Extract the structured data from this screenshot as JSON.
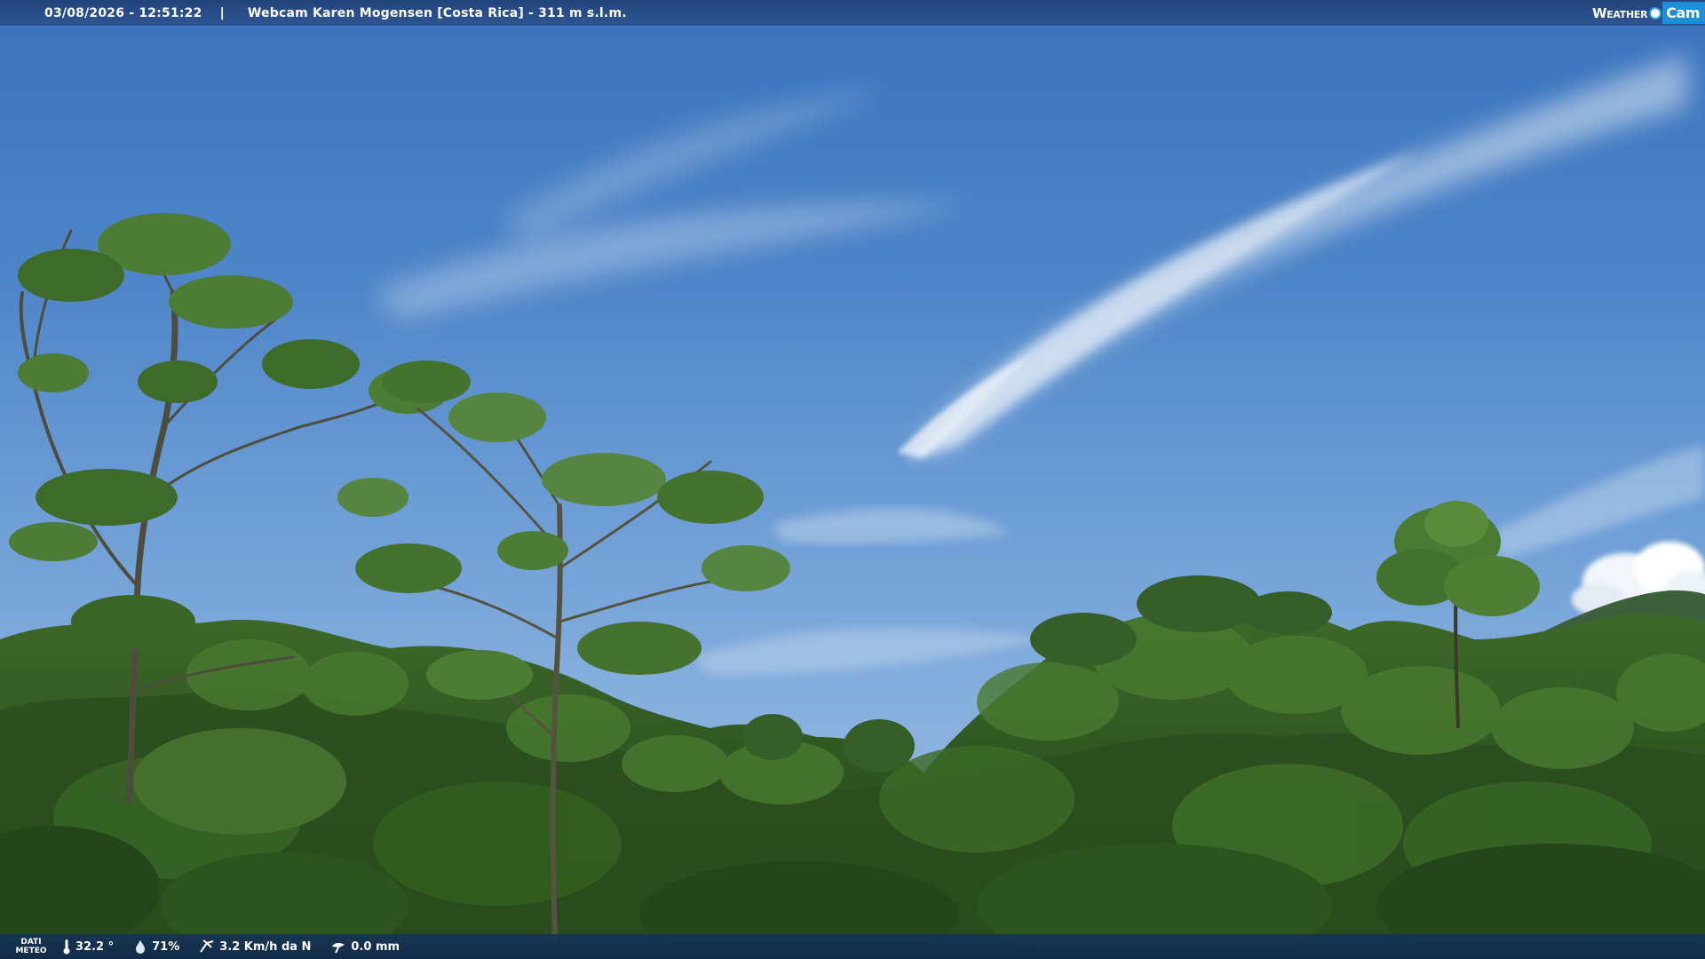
{
  "overlay": {
    "timestamp": "03/08/2026 - 12:51:22",
    "separator": "|",
    "title": "Webcam Karen Mogensen [Costa Rica] - 311 m s.l.m."
  },
  "brand": {
    "left": "Weather",
    "right": "Cam"
  },
  "weather": {
    "label_line1": "DATI",
    "label_line2": "METEO",
    "temperature": "32.2 °",
    "humidity": "71%",
    "wind": "3.2 Km/h da N",
    "rain": "0.0 mm"
  },
  "colors": {
    "bar": "#2c508c",
    "brand_accent": "#1d8fd8"
  },
  "icons": [
    "thermometer-icon",
    "humidity-drop-icon",
    "wind-icon",
    "rain-gauge-icon"
  ]
}
